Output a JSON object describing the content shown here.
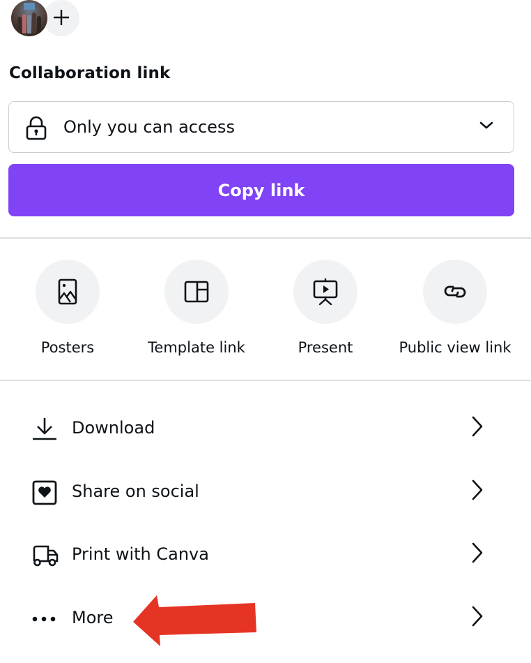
{
  "collaborators": {
    "avatar_alt": "Collaborator avatar",
    "add_button_symbol": "+"
  },
  "collaboration": {
    "title": "Collaboration link",
    "access_value": "Only you can access",
    "access_icon": "lock-icon",
    "copy_button_label": "Copy link"
  },
  "quick_actions": [
    {
      "label": "Posters",
      "icon": "poster-image-icon"
    },
    {
      "label": "Template link",
      "icon": "template-layout-icon"
    },
    {
      "label": "Present",
      "icon": "presentation-screen-icon"
    },
    {
      "label": "Public view link",
      "icon": "link-icon"
    }
  ],
  "menu": [
    {
      "label": "Download",
      "icon": "download-icon"
    },
    {
      "label": "Share on social",
      "icon": "heart-box-icon"
    },
    {
      "label": "Print with Canva",
      "icon": "delivery-truck-icon"
    },
    {
      "label": "More",
      "icon": "more-dots-icon"
    }
  ],
  "annotation": {
    "arrow_points_to": "More",
    "arrow_color": "#e63424"
  },
  "colors": {
    "accent": "#8043f5",
    "text": "#0e1318",
    "icon_bg": "#f1f2f4",
    "divider": "#dfe0e4"
  }
}
